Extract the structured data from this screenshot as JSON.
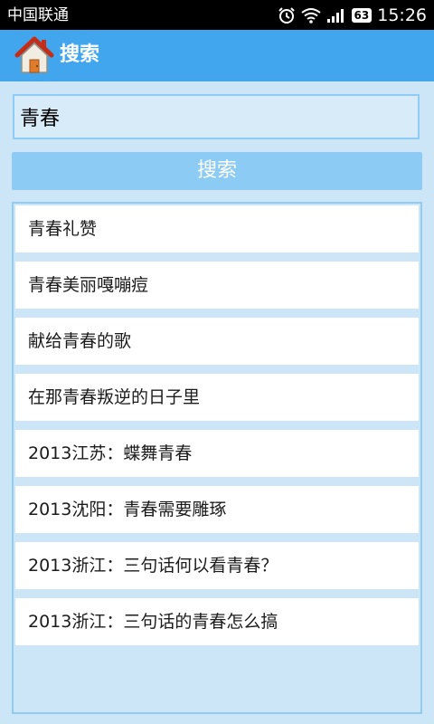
{
  "status_bar": {
    "carrier": "中国联通",
    "battery": "63",
    "time": "15:26",
    "icons": [
      "alarm-icon",
      "wifi-icon",
      "signal-icon",
      "battery-icon"
    ]
  },
  "header": {
    "title": "搜索",
    "icon": "home-icon",
    "colors": {
      "header_bg": "#42a6ee",
      "page_bg": "#cde6f7",
      "button_bg": "#8ccbf4",
      "border": "#8fcbf4"
    }
  },
  "search": {
    "value": "青春",
    "placeholder": "",
    "button_label": "搜索"
  },
  "results": [
    "青春礼赞",
    "青春美丽嘎嘣痘",
    "献给青春的歌",
    "在那青春叛逆的日子里",
    "2013江苏：蝶舞青春",
    "2013沈阳：青春需要雕琢",
    "2013浙江：三句话何以看青春？",
    "2013浙江：三句话的青春怎么搞"
  ]
}
